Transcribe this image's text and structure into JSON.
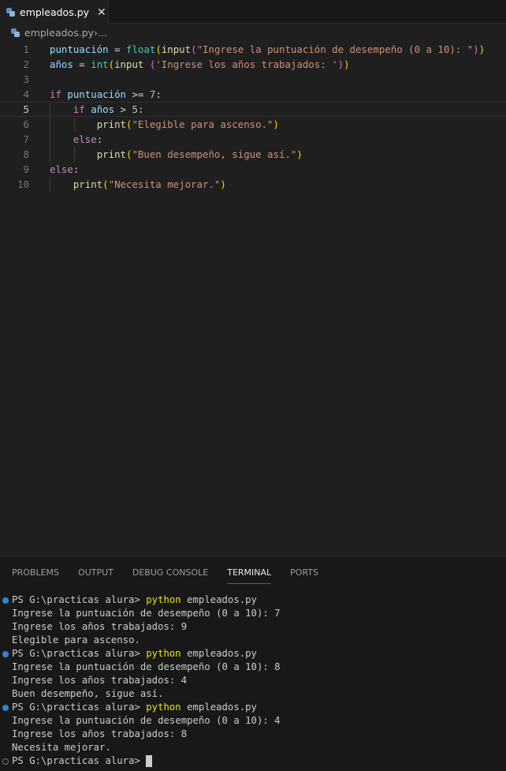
{
  "tab": {
    "title": "empleados.py",
    "close": "✕"
  },
  "breadcrumb": {
    "file": "empleados.py",
    "sep": " › ",
    "rest": "..."
  },
  "code": [
    {
      "n": "1",
      "t": [
        [
          "puntuación",
          "v"
        ],
        [
          " = ",
          "o"
        ],
        [
          "float",
          "g"
        ],
        [
          "(",
          "b1"
        ],
        [
          "input",
          "f"
        ],
        [
          "(",
          "b2"
        ],
        [
          "\"Ingrese la puntuación de desempeño (0 a 10): \"",
          "s"
        ],
        [
          ")",
          "b2"
        ],
        [
          ")",
          "b1"
        ]
      ]
    },
    {
      "n": "2",
      "t": [
        [
          "años",
          "v"
        ],
        [
          " = ",
          "o"
        ],
        [
          "int",
          "g"
        ],
        [
          "(",
          "b1"
        ],
        [
          "input",
          "f"
        ],
        [
          " ",
          "o"
        ],
        [
          "(",
          "b2"
        ],
        [
          "'Ingrese los años trabajados: '",
          "s"
        ],
        [
          ")",
          "b2"
        ],
        [
          ")",
          "b1"
        ]
      ]
    },
    {
      "n": "3",
      "t": []
    },
    {
      "n": "4",
      "t": [
        [
          "if",
          "k"
        ],
        [
          " ",
          "o"
        ],
        [
          "puntuación",
          "v"
        ],
        [
          " >= ",
          "o"
        ],
        [
          "7",
          "n"
        ],
        [
          ":",
          "o"
        ]
      ]
    },
    {
      "n": "5",
      "t": [
        [
          "    ",
          "o"
        ],
        [
          "if",
          "k"
        ],
        [
          " ",
          "o"
        ],
        [
          "años",
          "v"
        ],
        [
          " > ",
          "o"
        ],
        [
          "5",
          "n"
        ],
        [
          ":",
          "o"
        ]
      ]
    },
    {
      "n": "6",
      "t": [
        [
          "        ",
          "o"
        ],
        [
          "print",
          "f"
        ],
        [
          "(",
          "b1"
        ],
        [
          "\"Elegible para ascenso.\"",
          "s"
        ],
        [
          ")",
          "b1"
        ]
      ]
    },
    {
      "n": "7",
      "t": [
        [
          "    ",
          "o"
        ],
        [
          "else",
          "k"
        ],
        [
          ":",
          "o"
        ]
      ]
    },
    {
      "n": "8",
      "t": [
        [
          "        ",
          "o"
        ],
        [
          "print",
          "f"
        ],
        [
          "(",
          "b1"
        ],
        [
          "\"Buen desempeño, sigue así.\"",
          "s"
        ],
        [
          ")",
          "b1"
        ]
      ]
    },
    {
      "n": "9",
      "t": [
        [
          "else",
          "k"
        ],
        [
          ":",
          "o"
        ]
      ]
    },
    {
      "n": "10",
      "t": [
        [
          "    ",
          "o"
        ],
        [
          "print",
          "f"
        ],
        [
          "(",
          "b1"
        ],
        [
          "\"Necesita mejorar.\"",
          "s"
        ],
        [
          ")",
          "b1"
        ]
      ]
    }
  ],
  "panel": {
    "tabs": [
      "PROBLEMS",
      "OUTPUT",
      "DEBUG CONSOLE",
      "TERMINAL",
      "PORTS"
    ],
    "active": "TERMINAL"
  },
  "terminal": [
    {
      "prompt": "PS G:\\practicas alura> ",
      "cmd": "python",
      "arg": " empleados.py"
    },
    {
      "text": "Ingrese la puntuación de desempeño (0 a 10): 7"
    },
    {
      "text": "Ingrese los años trabajados: 9"
    },
    {
      "text": "Elegible para ascenso."
    },
    {
      "prompt": "PS G:\\practicas alura> ",
      "cmd": "python",
      "arg": " empleados.py"
    },
    {
      "text": "Ingrese la puntuación de desempeño (0 a 10): 8"
    },
    {
      "text": "Ingrese los años trabajados: 4"
    },
    {
      "text": "Buen desempeño, sigue así."
    },
    {
      "prompt": "PS G:\\practicas alura> ",
      "cmd": "python",
      "arg": " empleados.py"
    },
    {
      "text": "Ingrese la puntuación de desempeño (0 a 10): 4"
    },
    {
      "text": "Ingrese los años trabajados: 8"
    },
    {
      "text": "Necesita mejorar."
    },
    {
      "prompt": "PS G:\\practicas alura> ",
      "current": true
    }
  ]
}
